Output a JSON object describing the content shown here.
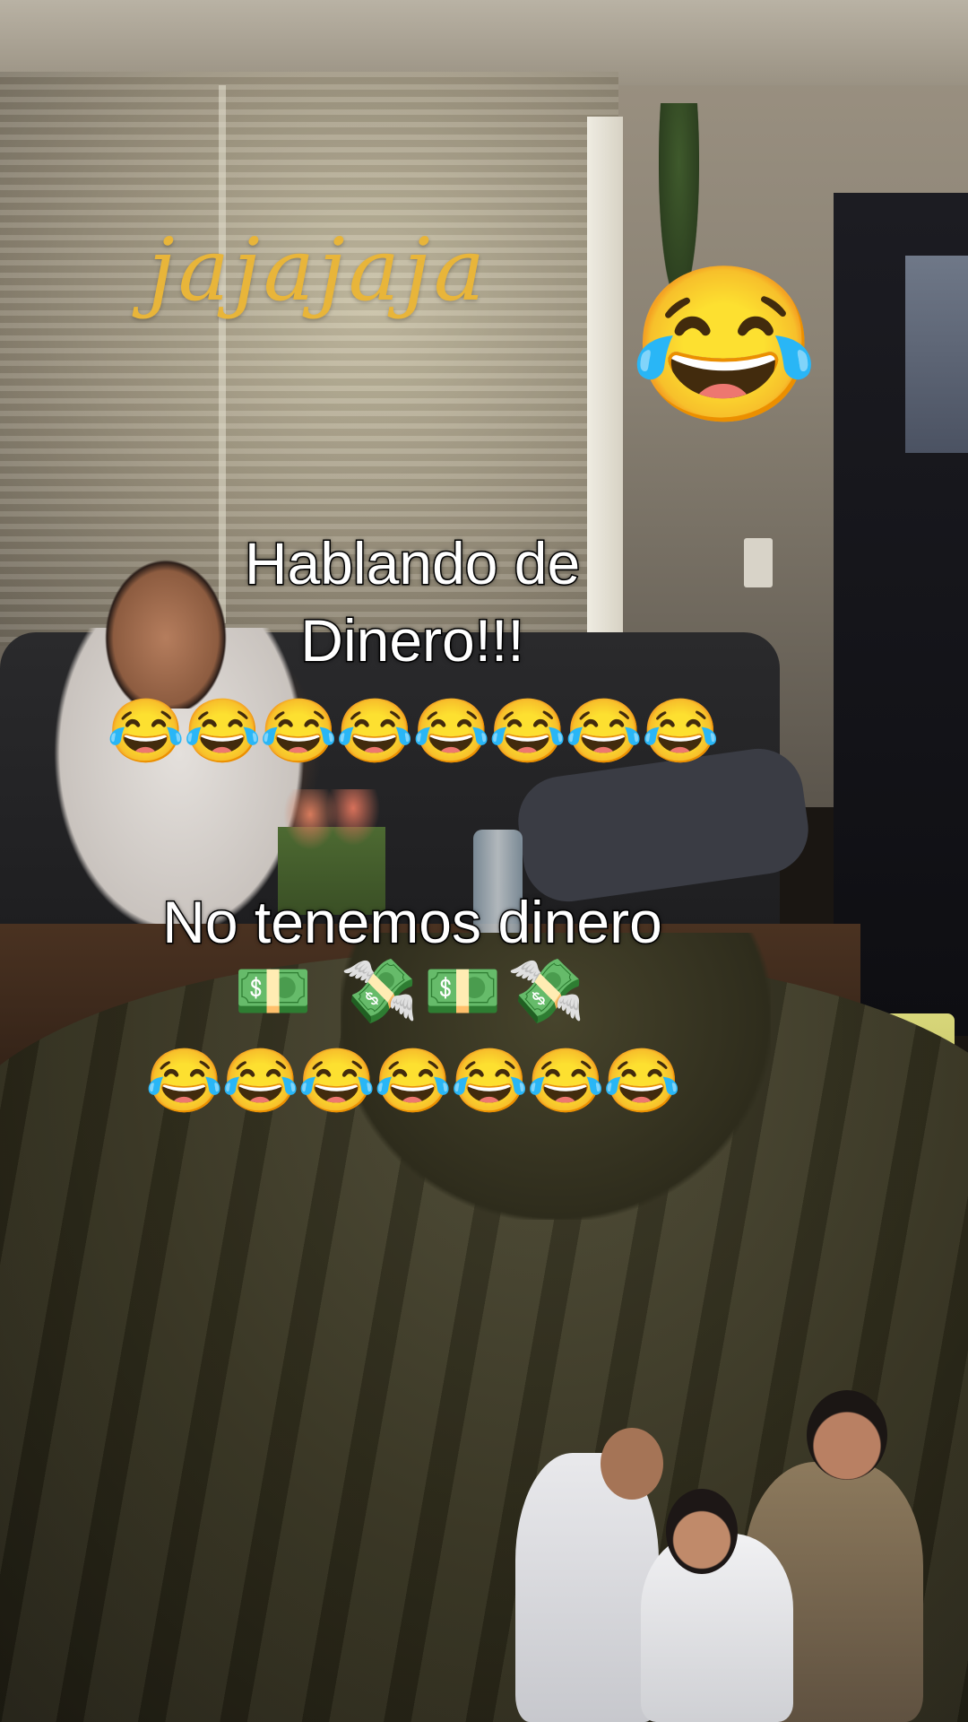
{
  "overlay": {
    "title": "jajajaja",
    "big_emoji": "😂",
    "caption_1": "Hablando de\nDinero!!!",
    "emoji_row_1": "😂😂😂😂😂😂😂😂",
    "caption_2": "No tenemos dinero",
    "emoji_row_2": "💵 💸💵💸",
    "emoji_row_3": "😂😂😂😂😂😂😂"
  },
  "colors": {
    "title_text": "#e8b53a",
    "caption_text": "#ffffff",
    "caption_outline": "#000000"
  },
  "sticker": {
    "icon": "laughing-group-sticker"
  }
}
